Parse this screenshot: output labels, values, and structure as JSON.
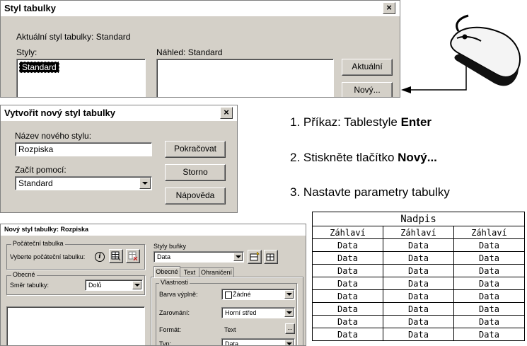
{
  "dialog1": {
    "title": "Styl tabulky",
    "close": "×",
    "current_style": "Aktuální styl tabulky: Standard",
    "styles_label": "Styly:",
    "styles_items": [
      "Standard"
    ],
    "preview_label": "Náhled: Standard",
    "btn_current": "Aktuální",
    "btn_new": "Nový..."
  },
  "dialog2": {
    "title": "Vytvořit nový styl tabulky",
    "close": "×",
    "name_label": "Název nového stylu:",
    "name_value": "Rozpiska",
    "start_label": "Začít pomocí:",
    "start_value": "Standard",
    "btn_continue": "Pokračovat",
    "btn_cancel": "Storno",
    "btn_help": "Nápověda"
  },
  "dialog3": {
    "title": "Nový styl tabulky: Rozpiska",
    "start_group": "Počáteční tabulka",
    "start_label": "Vyberte počáteční tabulku:",
    "general_group": "Obecné",
    "direction_label": "Směr tabulky:",
    "direction_value": "Dolů",
    "cell_styles_label": "Styly buňky",
    "cell_style_value": "Data",
    "tabs": [
      "Obecné",
      "Text",
      "Ohraničení"
    ],
    "props_group": "Vlastnosti",
    "fill_label": "Barva výplně:",
    "fill_value": "Žádné",
    "align_label": "Zarovnání:",
    "align_value": "Horní střed",
    "format_label": "Formát:",
    "format_value": "Text",
    "format_btn": "...",
    "type_label": "Typ:",
    "type_value": "Data"
  },
  "steps": [
    {
      "num": "1.",
      "text": "Příkaz: Tablestyle ",
      "bold": "Enter"
    },
    {
      "num": "2.",
      "text": "Stiskněte tlačítko ",
      "bold": "Nový..."
    },
    {
      "num": "3.",
      "text": "Nastavte parametry tabulky",
      "bold": ""
    }
  ],
  "table_preview": {
    "title": "Nadpis",
    "headers": [
      "Záhlaví",
      "Záhlaví",
      "Záhlaví"
    ],
    "rows": [
      [
        "Data",
        "Data",
        "Data"
      ],
      [
        "Data",
        "Data",
        "Data"
      ],
      [
        "Data",
        "Data",
        "Data"
      ],
      [
        "Data",
        "Data",
        "Data"
      ],
      [
        "Data",
        "Data",
        "Data"
      ],
      [
        "Data",
        "Data",
        "Data"
      ],
      [
        "Data",
        "Data",
        "Data"
      ],
      [
        "Data",
        "Data",
        "Data"
      ]
    ]
  },
  "icons": {
    "mouse": "computer-mouse-icon",
    "arrow": "left-arrow-icon",
    "info": "info-icon",
    "table_pick": "table-select-icon",
    "table_remove": "table-remove-icon",
    "cell_new": "new-cell-style-icon",
    "cell_manage": "manage-cell-styles-icon"
  }
}
